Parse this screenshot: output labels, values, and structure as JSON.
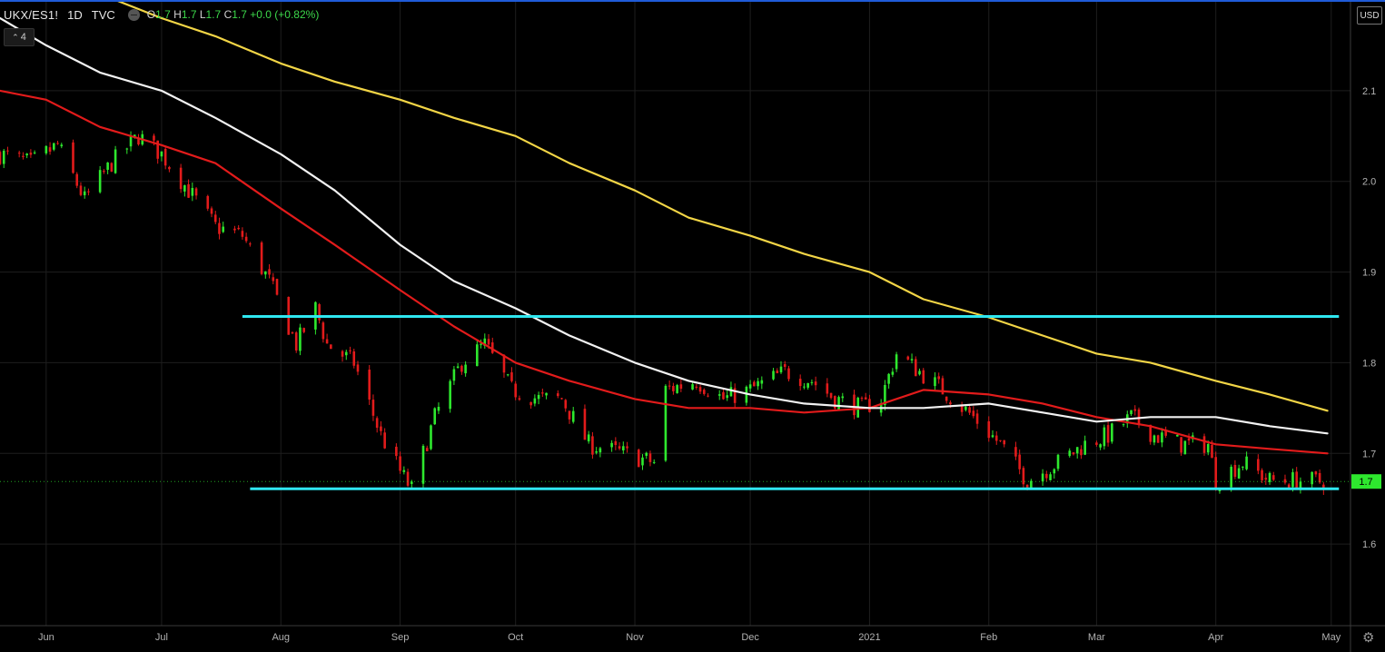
{
  "header": {
    "symbol": "UKX/ES1!",
    "interval": "1D",
    "source": "TVC",
    "o_label": "O",
    "o_value": "1.7",
    "h_label": "H",
    "h_value": "1.7",
    "l_label": "L",
    "l_value": "1.7",
    "c_label": "C",
    "c_value": "1.7",
    "change": "+0.0 (+0.82%)"
  },
  "studies_count": "4",
  "currency_button": "USD",
  "settings_icon": "gear-icon",
  "colors": {
    "background": "#000000",
    "grid": "#1e1e1e",
    "up": "#2ee82e",
    "down": "#e21b1b",
    "ma_fast": "#e21b1b",
    "ma_mid": "#f2f2f2",
    "ma_slow": "#f2d546",
    "level": "#2fe7f0",
    "price_badge": "#2ee82e"
  },
  "chart_data": {
    "type": "candlestick",
    "x_axis": {
      "range": [
        "2020-05-20",
        "2021-05-06"
      ],
      "ticks": [
        {
          "date": "2020-06-01",
          "label": "Jun"
        },
        {
          "date": "2020-07-01",
          "label": "Jul"
        },
        {
          "date": "2020-08-01",
          "label": "Aug"
        },
        {
          "date": "2020-09-01",
          "label": "Sep"
        },
        {
          "date": "2020-10-01",
          "label": "Oct"
        },
        {
          "date": "2020-11-01",
          "label": "Nov"
        },
        {
          "date": "2020-12-01",
          "label": "Dec"
        },
        {
          "date": "2021-01-01",
          "label": "2021"
        },
        {
          "date": "2021-02-01",
          "label": "Feb"
        },
        {
          "date": "2021-03-01",
          "label": "Mar"
        },
        {
          "date": "2021-04-01",
          "label": "Apr"
        },
        {
          "date": "2021-05-01",
          "label": "May"
        }
      ]
    },
    "y_axis": {
      "range": [
        1.51,
        2.2
      ],
      "ticks": [
        "1.6",
        "1.7",
        "1.8",
        "1.9",
        "2.0",
        "2.1"
      ],
      "position": "right"
    },
    "last_price": {
      "value": 1.669,
      "label": "1.7"
    },
    "grid": true,
    "close_path": [
      [
        "2020-05-20",
        2.03
      ],
      [
        "2020-05-28",
        2.02
      ],
      [
        "2020-06-04",
        2.04
      ],
      [
        "2020-06-11",
        1.98
      ],
      [
        "2020-06-18",
        2.02
      ],
      [
        "2020-06-25",
        2.05
      ],
      [
        "2020-07-01",
        2.03
      ],
      [
        "2020-07-08",
        1.99
      ],
      [
        "2020-07-15",
        1.95
      ],
      [
        "2020-07-22",
        1.94
      ],
      [
        "2020-07-29",
        1.89
      ],
      [
        "2020-08-05",
        1.82
      ],
      [
        "2020-08-10",
        1.86
      ],
      [
        "2020-08-13",
        1.82
      ],
      [
        "2020-08-20",
        1.8
      ],
      [
        "2020-08-27",
        1.72
      ],
      [
        "2020-09-01",
        1.68
      ],
      [
        "2020-09-04",
        1.66
      ],
      [
        "2020-09-10",
        1.74
      ],
      [
        "2020-09-17",
        1.8
      ],
      [
        "2020-09-23",
        1.82
      ],
      [
        "2020-09-30",
        1.77
      ],
      [
        "2020-10-07",
        1.76
      ],
      [
        "2020-10-13",
        1.76
      ],
      [
        "2020-10-20",
        1.71
      ],
      [
        "2020-10-29",
        1.7
      ],
      [
        "2020-11-06",
        1.69
      ],
      [
        "2020-11-09",
        1.77
      ],
      [
        "2020-11-17",
        1.78
      ],
      [
        "2020-11-24",
        1.76
      ],
      [
        "2020-12-01",
        1.77
      ],
      [
        "2020-12-10",
        1.79
      ],
      [
        "2020-12-17",
        1.78
      ],
      [
        "2020-12-23",
        1.76
      ],
      [
        "2020-12-30",
        1.75
      ],
      [
        "2021-01-04",
        1.76
      ],
      [
        "2021-01-08",
        1.81
      ],
      [
        "2021-01-14",
        1.79
      ],
      [
        "2021-01-20",
        1.77
      ],
      [
        "2021-01-28",
        1.74
      ],
      [
        "2021-02-04",
        1.71
      ],
      [
        "2021-02-11",
        1.67
      ],
      [
        "2021-02-19",
        1.69
      ],
      [
        "2021-02-26",
        1.71
      ],
      [
        "2021-03-04",
        1.72
      ],
      [
        "2021-03-10",
        1.74
      ],
      [
        "2021-03-16",
        1.72
      ],
      [
        "2021-03-23",
        1.71
      ],
      [
        "2021-03-30",
        1.71
      ],
      [
        "2021-04-01",
        1.67
      ],
      [
        "2021-04-08",
        1.69
      ],
      [
        "2021-04-15",
        1.67
      ],
      [
        "2021-04-22",
        1.67
      ],
      [
        "2021-04-29",
        1.669
      ]
    ],
    "series": [
      {
        "kind": "moving-average",
        "color": "#e21b1b",
        "points": [
          [
            "2020-05-20",
            2.1
          ],
          [
            "2020-06-01",
            2.09
          ],
          [
            "2020-06-15",
            2.06
          ],
          [
            "2020-07-01",
            2.04
          ],
          [
            "2020-07-15",
            2.02
          ],
          [
            "2020-08-01",
            1.97
          ],
          [
            "2020-08-15",
            1.93
          ],
          [
            "2020-09-01",
            1.88
          ],
          [
            "2020-09-15",
            1.84
          ],
          [
            "2020-10-01",
            1.8
          ],
          [
            "2020-10-15",
            1.78
          ],
          [
            "2020-11-01",
            1.76
          ],
          [
            "2020-11-15",
            1.75
          ],
          [
            "2020-12-01",
            1.75
          ],
          [
            "2020-12-15",
            1.745
          ],
          [
            "2021-01-01",
            1.75
          ],
          [
            "2021-01-15",
            1.77
          ],
          [
            "2021-02-01",
            1.765
          ],
          [
            "2021-02-15",
            1.755
          ],
          [
            "2021-03-01",
            1.74
          ],
          [
            "2021-03-15",
            1.73
          ],
          [
            "2021-04-01",
            1.71
          ],
          [
            "2021-04-15",
            1.705
          ],
          [
            "2021-04-30",
            1.7
          ]
        ]
      },
      {
        "kind": "moving-average",
        "color": "#f2f2f2",
        "points": [
          [
            "2020-05-20",
            2.18
          ],
          [
            "2020-06-01",
            2.15
          ],
          [
            "2020-06-15",
            2.12
          ],
          [
            "2020-07-01",
            2.1
          ],
          [
            "2020-07-15",
            2.07
          ],
          [
            "2020-08-01",
            2.03
          ],
          [
            "2020-08-15",
            1.99
          ],
          [
            "2020-09-01",
            1.93
          ],
          [
            "2020-09-15",
            1.89
          ],
          [
            "2020-10-01",
            1.86
          ],
          [
            "2020-10-15",
            1.83
          ],
          [
            "2020-11-01",
            1.8
          ],
          [
            "2020-11-15",
            1.78
          ],
          [
            "2020-12-01",
            1.765
          ],
          [
            "2020-12-15",
            1.755
          ],
          [
            "2021-01-01",
            1.75
          ],
          [
            "2021-01-15",
            1.75
          ],
          [
            "2021-02-01",
            1.755
          ],
          [
            "2021-02-15",
            1.745
          ],
          [
            "2021-03-01",
            1.735
          ],
          [
            "2021-03-15",
            1.74
          ],
          [
            "2021-04-01",
            1.74
          ],
          [
            "2021-04-15",
            1.73
          ],
          [
            "2021-04-30",
            1.722
          ]
        ]
      },
      {
        "kind": "moving-average",
        "color": "#f2d546",
        "points": [
          [
            "2020-06-19",
            2.2
          ],
          [
            "2020-07-01",
            2.18
          ],
          [
            "2020-07-15",
            2.16
          ],
          [
            "2020-08-01",
            2.13
          ],
          [
            "2020-08-15",
            2.11
          ],
          [
            "2020-09-01",
            2.09
          ],
          [
            "2020-09-15",
            2.07
          ],
          [
            "2020-10-01",
            2.05
          ],
          [
            "2020-10-15",
            2.02
          ],
          [
            "2020-11-01",
            1.99
          ],
          [
            "2020-11-15",
            1.96
          ],
          [
            "2020-12-01",
            1.94
          ],
          [
            "2020-12-15",
            1.92
          ],
          [
            "2021-01-01",
            1.9
          ],
          [
            "2021-01-15",
            1.87
          ],
          [
            "2021-02-01",
            1.85
          ],
          [
            "2021-02-15",
            1.83
          ],
          [
            "2021-03-01",
            1.81
          ],
          [
            "2021-03-15",
            1.8
          ],
          [
            "2021-04-01",
            1.78
          ],
          [
            "2021-04-15",
            1.765
          ],
          [
            "2021-04-30",
            1.747
          ]
        ]
      }
    ],
    "horizontal_levels": [
      {
        "value": 1.851,
        "from": "2020-07-22",
        "to": "2021-05-03",
        "color": "#2fe7f0"
      },
      {
        "value": 1.661,
        "from": "2020-07-24",
        "to": "2021-05-03",
        "color": "#2fe7f0"
      }
    ]
  }
}
